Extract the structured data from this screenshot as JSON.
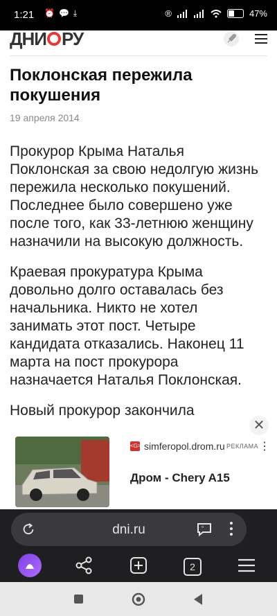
{
  "status_bar": {
    "time": "1:21",
    "left_icons": [
      "alarm-icon",
      "chat-icon",
      "download-icon"
    ],
    "battery_text": "47%",
    "battery_level": 0.47
  },
  "site": {
    "logo_parts": [
      "ДНИ",
      "РУ"
    ]
  },
  "article": {
    "title": "Поклонская пережила покушения",
    "date": "19 апреля 2014",
    "paragraphs": [
      "Прокурор Крыма Наталья Поклонская за свою недолгую жизнь пережила несколько покушений. Последнее было совершено уже после того, как 33-летнюю женщину назначили на высокую должность.",
      "Краевая прокуратура Крыма довольно долго оставалась без начальника. Никто не хотел занимать этот пост. Четыре кандидата отказались. Наконец 11 марта на пост прокурора назначается Наталья Поклонская.",
      "Новый прокурор закончила"
    ]
  },
  "ad": {
    "domain": "simferopol.drom.ru",
    "label": "РЕКЛАМА",
    "headline": "Дром - Chery A15",
    "favicon_text": "<G>"
  },
  "browser": {
    "url": "dni.ru",
    "tab_count": "2"
  },
  "colors": {
    "logo_accent": "#e53935",
    "browser_bg": "#1f1f21",
    "alice_accent": "#8e4dff"
  }
}
